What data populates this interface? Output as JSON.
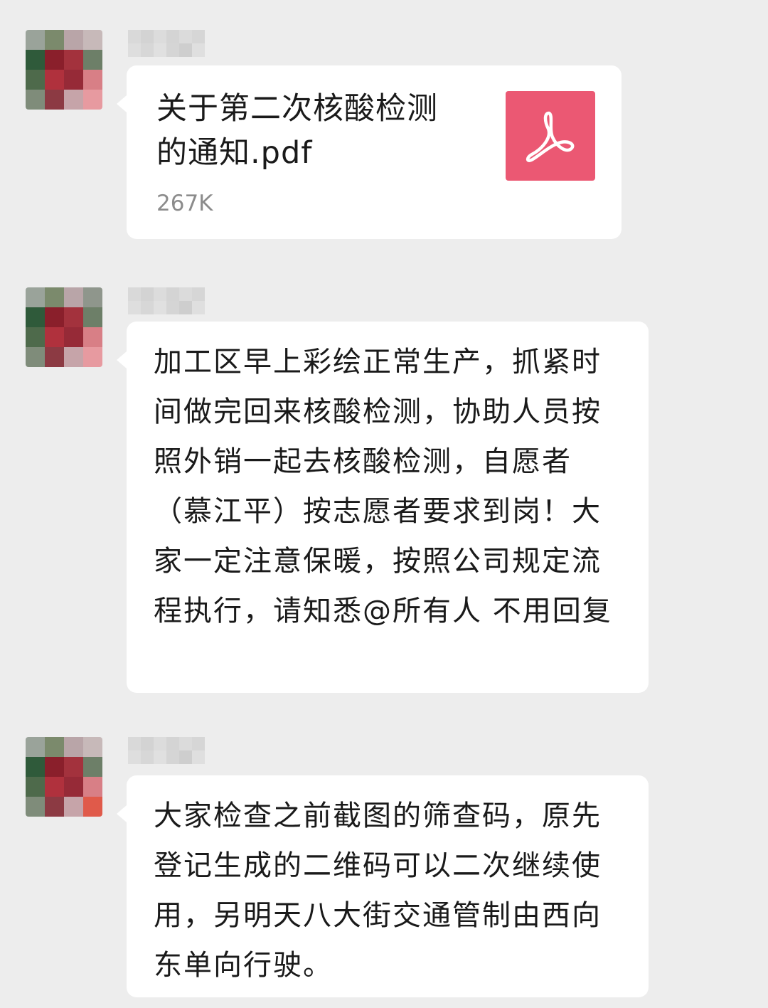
{
  "messages": [
    {
      "type": "file",
      "file_name": "关于第二次核酸检测的通知.pdf",
      "file_size": "267K",
      "file_icon": "pdf-icon",
      "file_icon_color": "#eb5873"
    },
    {
      "type": "text",
      "text": "加工区早上彩绘正常生产，抓紧时间做完回来核酸检测，协助人员按照外销一起去核酸检测，自愿者（慕江平）按志愿者要求到岗！大家一定注意保暖，按照公司规定流程执行，请知悉@所有人 不用回复"
    },
    {
      "type": "text",
      "text": "大家检查之前截图的筛查码，原先登记生成的二维码可以二次继续使用，另明天八大街交通管制由西向东单向行驶。"
    }
  ],
  "colors": {
    "background": "#ededed",
    "bubble": "#ffffff",
    "pdf_accent": "#eb5873"
  }
}
